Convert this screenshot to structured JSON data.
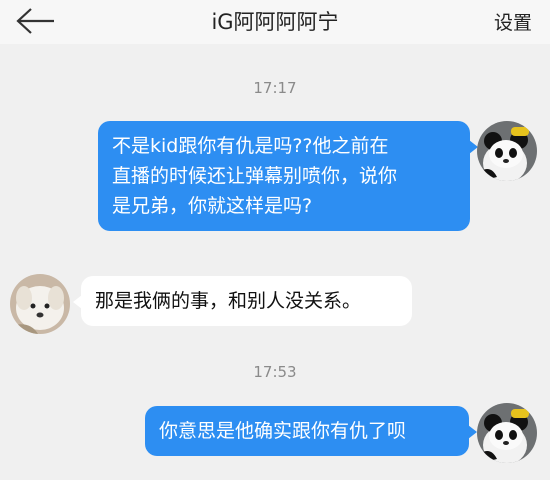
{
  "header": {
    "title": "iG阿阿阿阿宁",
    "settings_label": "设置",
    "back_icon": "back-arrow-icon"
  },
  "messages": [
    {
      "time": "17:17"
    },
    {
      "side": "out",
      "text": "不是kid跟你有仇是吗??他之前在\n直播的时候还让弹幕别喷你，说你\n是兄弟，你就这样是吗?"
    },
    {
      "side": "in",
      "text": "那是我俩的事，和别人没关系。"
    },
    {
      "time": "17:53"
    },
    {
      "side": "out",
      "text": "你意思是他确实跟你有仇了呗"
    }
  ],
  "avatars": {
    "self": "panda-avatar",
    "other": "dog-avatar"
  },
  "colors": {
    "outgoing_bubble": "#2d8ef2",
    "incoming_bubble": "#ffffff",
    "background": "#f0f0f0"
  }
}
